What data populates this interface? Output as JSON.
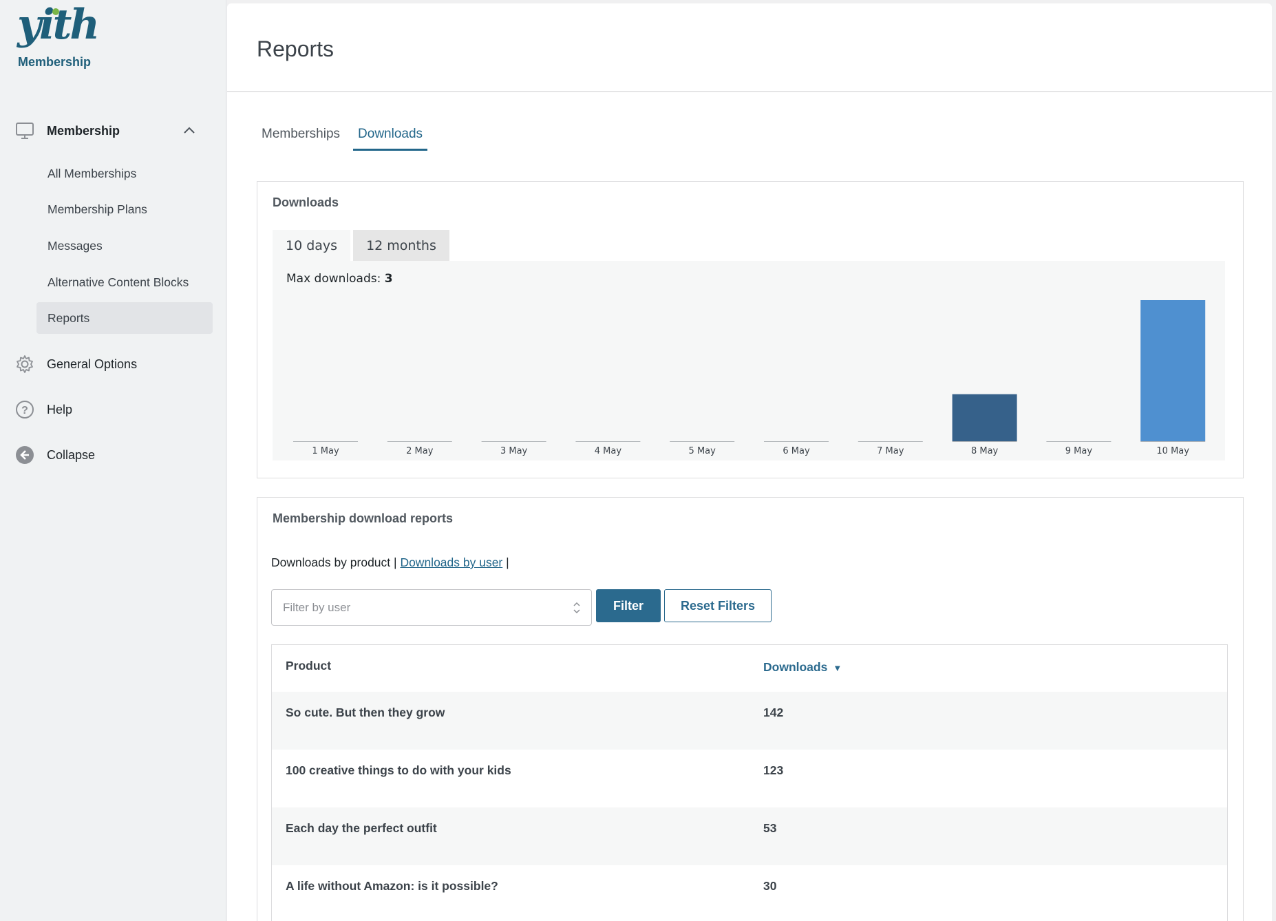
{
  "sidebar": {
    "logo": "yith",
    "brand_sub": "Membership",
    "main_item": "Membership",
    "sub_items": [
      {
        "label": "All Memberships"
      },
      {
        "label": "Membership Plans"
      },
      {
        "label": "Messages"
      },
      {
        "label": "Alternative Content Blocks"
      },
      {
        "label": "Reports"
      }
    ],
    "general_options": "General Options",
    "help": "Help",
    "collapse": "Collapse"
  },
  "header": {
    "title": "Reports"
  },
  "tabs": [
    {
      "label": "Memberships"
    },
    {
      "label": "Downloads"
    }
  ],
  "downloads_panel": {
    "title": "Downloads",
    "ranges": [
      "10 days",
      "12 months"
    ],
    "max_label": "Max downloads:",
    "max_value": "3"
  },
  "chart_data": {
    "type": "bar",
    "categories": [
      "1 May",
      "2 May",
      "3 May",
      "4 May",
      "5 May",
      "6 May",
      "7 May",
      "8 May",
      "9 May",
      "10 May"
    ],
    "values": [
      0,
      0,
      0,
      0,
      0,
      0,
      0,
      1,
      0,
      3
    ],
    "ylim": [
      0,
      3
    ],
    "highlight_color": "#4f90d0",
    "bar_color": "#36618a"
  },
  "reports_panel": {
    "title": "Membership download reports",
    "by_product": "Downloads by product |",
    "by_user": "Downloads by user",
    "sep": "|",
    "filter_placeholder": "Filter by user",
    "filter_button": "Filter",
    "reset_button": "Reset Filters"
  },
  "table": {
    "col_product": "Product",
    "col_downloads": "Downloads",
    "rows": [
      {
        "product": "So cute. But then they grow",
        "downloads": "142"
      },
      {
        "product": "100 creative things to do with your kids",
        "downloads": "123"
      },
      {
        "product": "Each day the perfect outfit",
        "downloads": "53"
      },
      {
        "product": "A life without Amazon: is it possible?",
        "downloads": "30"
      }
    ]
  },
  "colors": {
    "accent": "#22668a",
    "button": "#2b6a8e"
  }
}
